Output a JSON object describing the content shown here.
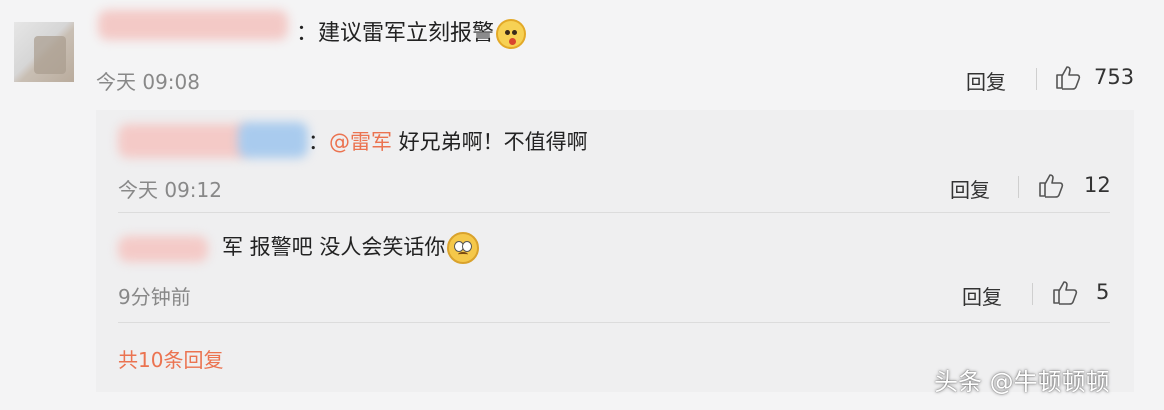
{
  "main_comment": {
    "text": "：建议雷军立刻报警",
    "emoji": "dog-face-emoji",
    "time": "今天 09:08",
    "reply_label": "回复",
    "likes": "753"
  },
  "replies": [
    {
      "prefix": "：",
      "mention": "@雷军",
      "text": " 好兄弟啊！不值得啊",
      "time": "今天 09:12",
      "reply_label": "回复",
      "likes": "12"
    },
    {
      "text": "军 报警吧 没人会笑话你",
      "emoji": "pleading-face-emoji",
      "time": "9分钟前",
      "reply_label": "回复",
      "likes": "5"
    }
  ],
  "more_replies": "共10条回复",
  "watermark": "头条 @牛顿顿顿",
  "colors": {
    "accent": "#eb7350",
    "muted": "#888888",
    "panel": "#efeff0",
    "page": "#f4f4f5"
  }
}
